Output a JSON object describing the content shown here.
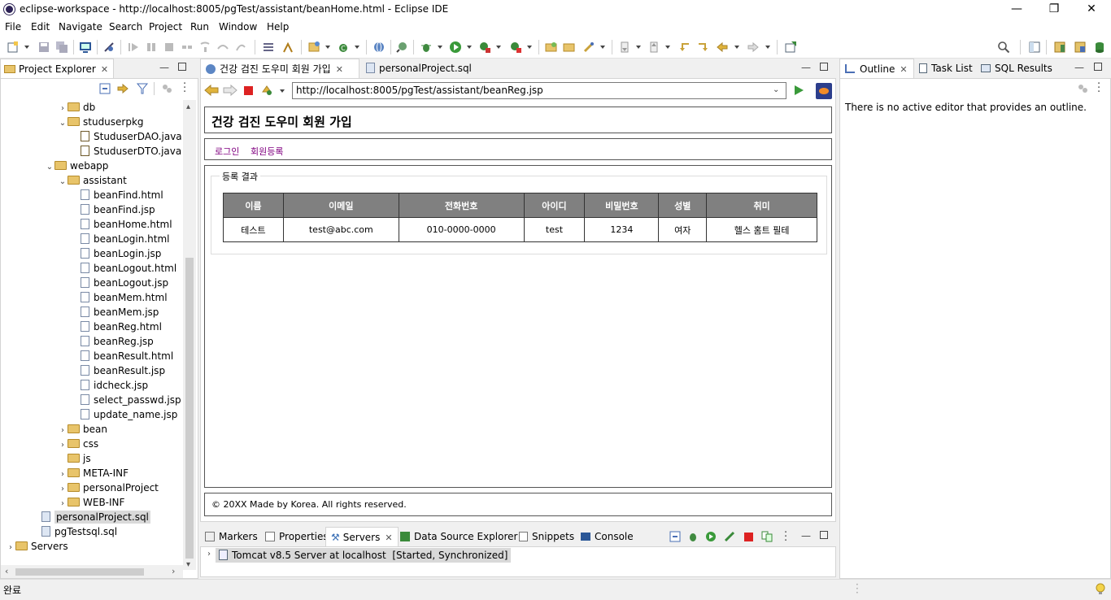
{
  "window": {
    "title": "eclipse-workspace - http://localhost:8005/pgTest/assistant/beanHome.html - Eclipse IDE",
    "minimize": "—",
    "restore": "❐",
    "close": "✕"
  },
  "menu": [
    "File",
    "Edit",
    "Navigate",
    "Search",
    "Project",
    "Run",
    "Window",
    "Help"
  ],
  "project_explorer": {
    "tab_label": "Project Explorer",
    "tree": [
      {
        "label": "db",
        "type": "folder",
        "depth": 4,
        "expanded": false
      },
      {
        "label": "studuserpkg",
        "type": "folder",
        "depth": 4,
        "expanded": true
      },
      {
        "label": "StuduserDAO.java",
        "type": "java",
        "depth": 5
      },
      {
        "label": "StuduserDTO.java",
        "type": "java",
        "depth": 5
      },
      {
        "label": "webapp",
        "type": "folder",
        "depth": 3,
        "expanded": true
      },
      {
        "label": "assistant",
        "type": "folder",
        "depth": 4,
        "expanded": true
      },
      {
        "label": "beanFind.html",
        "type": "file",
        "depth": 5
      },
      {
        "label": "beanFind.jsp",
        "type": "file",
        "depth": 5
      },
      {
        "label": "beanHome.html",
        "type": "file",
        "depth": 5
      },
      {
        "label": "beanLogin.html",
        "type": "file",
        "depth": 5
      },
      {
        "label": "beanLogin.jsp",
        "type": "file",
        "depth": 5
      },
      {
        "label": "beanLogout.html",
        "type": "file",
        "depth": 5
      },
      {
        "label": "beanLogout.jsp",
        "type": "file",
        "depth": 5
      },
      {
        "label": "beanMem.html",
        "type": "file",
        "depth": 5
      },
      {
        "label": "beanMem.jsp",
        "type": "file",
        "depth": 5
      },
      {
        "label": "beanReg.html",
        "type": "file",
        "depth": 5
      },
      {
        "label": "beanReg.jsp",
        "type": "file",
        "depth": 5
      },
      {
        "label": "beanResult.html",
        "type": "file",
        "depth": 5
      },
      {
        "label": "beanResult.jsp",
        "type": "file",
        "depth": 5
      },
      {
        "label": "idcheck.jsp",
        "type": "file",
        "depth": 5
      },
      {
        "label": "select_passwd.jsp",
        "type": "file",
        "depth": 5
      },
      {
        "label": "update_name.jsp",
        "type": "file",
        "depth": 5
      },
      {
        "label": "bean",
        "type": "folder",
        "depth": 4,
        "expanded": false
      },
      {
        "label": "css",
        "type": "folder",
        "depth": 4,
        "expanded": false
      },
      {
        "label": "js",
        "type": "folder",
        "depth": 4,
        "expanded": null
      },
      {
        "label": "META-INF",
        "type": "folder",
        "depth": 4,
        "expanded": false
      },
      {
        "label": "personalProject",
        "type": "folder",
        "depth": 4,
        "expanded": false
      },
      {
        "label": "WEB-INF",
        "type": "folder",
        "depth": 4,
        "expanded": false
      },
      {
        "label": "personalProject.sql",
        "type": "sql",
        "depth": 2,
        "selected": true
      },
      {
        "label": "pgTestsql.sql",
        "type": "sql",
        "depth": 2
      },
      {
        "label": "Servers",
        "type": "folder",
        "depth": 0,
        "expanded": false
      }
    ]
  },
  "editor": {
    "tabs": [
      {
        "label": "건강 검진 도우미 회원 가입",
        "active": true
      },
      {
        "label": "personalProject.sql",
        "active": false
      }
    ],
    "url": "http://localhost:8005/pgTest/assistant/beanReg.jsp"
  },
  "web_page": {
    "header": "건강 검진 도우미 회원 가입",
    "nav": [
      "로그인",
      "회원등록"
    ],
    "legend": "등록 결과",
    "table": {
      "headers": [
        "이름",
        "이메일",
        "전화번호",
        "아이디",
        "비밀번호",
        "성별",
        "취미"
      ],
      "rows": [
        [
          "테스트",
          "test@abc.com",
          "010-0000-0000",
          "test",
          "1234",
          "여자",
          "헬스 홈트 필테"
        ]
      ]
    },
    "footer": "© 20XX Made by Korea. All rights reserved."
  },
  "outline": {
    "tabs": [
      "Outline",
      "Task List",
      "SQL Results"
    ],
    "message": "There is no active editor that provides an outline."
  },
  "bottom_panel": {
    "tabs": [
      "Markers",
      "Properties",
      "Servers",
      "Data Source Explorer",
      "Snippets",
      "Console"
    ],
    "server_row": "Tomcat v8.5 Server at localhost  [Started, Synchronized]"
  },
  "status": "완료",
  "colors": {
    "nav_link": "#800080",
    "th_bg": "#808080",
    "selection": "#d9d9d9"
  }
}
